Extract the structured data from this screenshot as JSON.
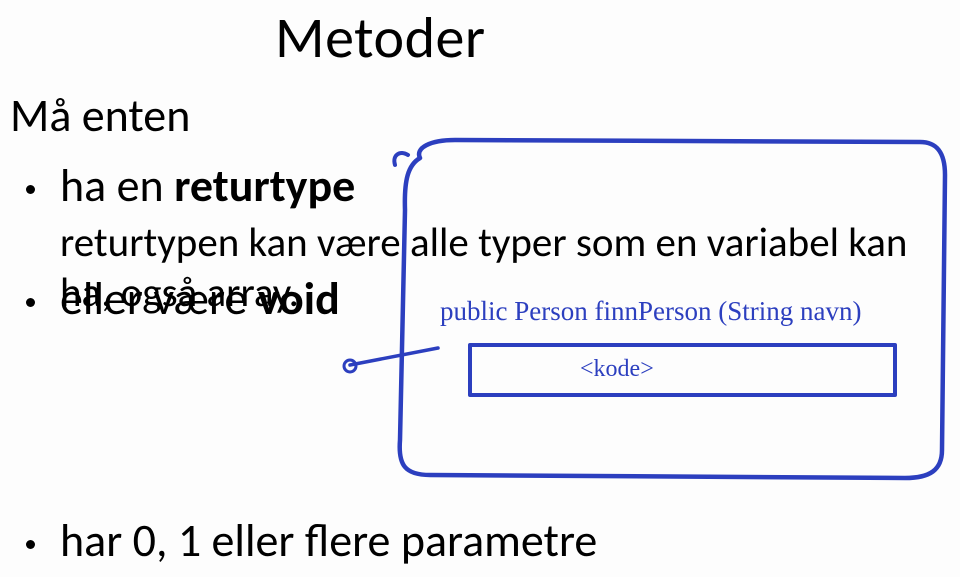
{
  "title": "Metoder",
  "subtitle": "Må enten",
  "bullets": {
    "b1_prefix": "ha en ",
    "b1_bold": "returtype",
    "b1_sub": "returtypen kan være alle typer som en variabel kan ha, også array.",
    "b2_prefix": "eller være ",
    "b2_bold": "void",
    "b3": "har 0, 1 eller flere parametre"
  },
  "handwriting": {
    "signature": "public Person finnPerson (String navn)",
    "body": "<kode>"
  }
}
